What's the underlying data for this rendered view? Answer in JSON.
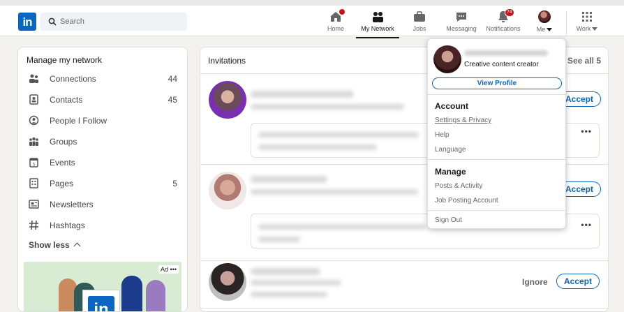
{
  "brand": {
    "logo_text": "in",
    "accent": "#0a66c2"
  },
  "search": {
    "placeholder": "Search"
  },
  "nav": [
    {
      "id": "home",
      "label": "Home",
      "icon": "home-icon",
      "badge": ""
    },
    {
      "id": "network",
      "label": "My Network",
      "icon": "people-icon",
      "badge": ""
    },
    {
      "id": "jobs",
      "label": "Jobs",
      "icon": "briefcase-icon",
      "badge": ""
    },
    {
      "id": "messaging",
      "label": "Messaging",
      "icon": "chat-icon",
      "badge": ""
    },
    {
      "id": "notifications",
      "label": "Notifications",
      "icon": "bell-icon",
      "badge": "74"
    },
    {
      "id": "me",
      "label": "Me",
      "icon": "avatar"
    },
    {
      "id": "work",
      "label": "Work",
      "icon": "grid-icon"
    }
  ],
  "left": {
    "title": "Manage my network",
    "items": [
      {
        "label": "Connections",
        "count": "44",
        "icon": "connections-icon"
      },
      {
        "label": "Contacts",
        "count": "45",
        "icon": "contacts-icon"
      },
      {
        "label": "People I Follow",
        "count": "",
        "icon": "follow-icon"
      },
      {
        "label": "Groups",
        "count": "",
        "icon": "groups-icon"
      },
      {
        "label": "Events",
        "count": "",
        "icon": "calendar-icon"
      },
      {
        "label": "Pages",
        "count": "5",
        "icon": "pages-icon"
      },
      {
        "label": "Newsletters",
        "count": "",
        "icon": "newsletter-icon"
      },
      {
        "label": "Hashtags",
        "count": "",
        "icon": "hashtag-icon"
      }
    ],
    "show_less": "Show less",
    "ad": {
      "label": "Ad",
      "more": "•••",
      "logo_text": "in"
    }
  },
  "invitations": {
    "title": "Invitations",
    "see_all": "See all 5",
    "accept_label": "Accept",
    "ignore_label": "Ignore",
    "more": "•••"
  },
  "menu": {
    "headline": "Creative content creator",
    "view_profile": "View Profile",
    "account_title": "Account",
    "account_links": [
      "Settings & Privacy",
      "Help",
      "Language"
    ],
    "manage_title": "Manage",
    "manage_links": [
      "Posts & Activity",
      "Job Posting Account"
    ],
    "sign_out": "Sign Out"
  }
}
